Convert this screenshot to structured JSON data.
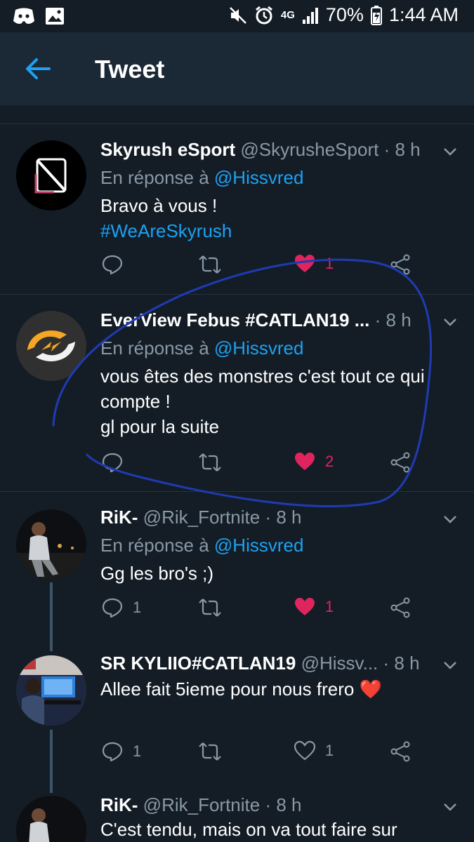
{
  "status_bar": {
    "battery": "70%",
    "time": "1:44 AM",
    "network": "4G"
  },
  "header": {
    "title": "Tweet"
  },
  "tweets": [
    {
      "name": "Skyrush eSport",
      "handle": "@SkyrusheSport",
      "time": "· 8 h",
      "reply_prefix": "En réponse à",
      "reply_to": "@Hissvred",
      "body": "Bravo à vous !",
      "hashtag": "#WeAreSkyrush",
      "reply_count": "",
      "like_count": "1",
      "liked": true
    },
    {
      "name": "EverView Febus #CATLAN19 ...",
      "handle": "",
      "time": "· 8 h",
      "reply_prefix": "En réponse à",
      "reply_to": "@Hissvred",
      "body_lines": [
        "vous êtes des monstres c'est tout ce qui",
        "compte !",
        "gl pour la suite"
      ],
      "reply_count": "",
      "like_count": "2",
      "liked": true
    },
    {
      "name": "RiK-",
      "handle": "@Rik_Fortnite",
      "time": "· 8 h",
      "reply_prefix": "En réponse à",
      "reply_to": "@Hissvred",
      "body": "Gg les bro's ;)",
      "reply_count": "1",
      "like_count": "1",
      "liked": true
    },
    {
      "name": "SR KYLIIO#CATLAN19",
      "handle": "@Hissv...",
      "time": "· 8 h",
      "body": "Allee fait 5ieme pour nous frero ❤️",
      "reply_count": "1",
      "like_count": "1",
      "liked": false
    },
    {
      "name": "RiK-",
      "handle": "@Rik_Fortnite",
      "time": "· 8 h",
      "body": "C'est tendu, mais on va tout faire sur"
    }
  ],
  "colors": {
    "background": "#141d26",
    "header": "#1b2836",
    "accent": "#1da1f2",
    "like": "#e0245e",
    "muted": "#8899a6",
    "annotation": "#1f3bb3"
  }
}
